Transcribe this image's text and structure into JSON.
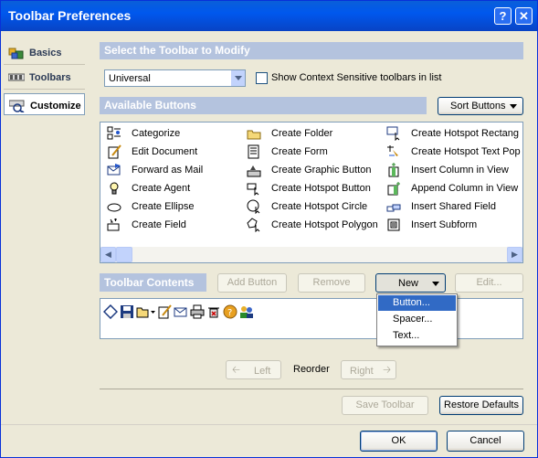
{
  "window": {
    "title": "Toolbar Preferences",
    "help_glyph": "?",
    "close_glyph": "✕"
  },
  "sidebar": {
    "items": [
      {
        "label": "Basics",
        "icon": "basics-icon",
        "selected": false
      },
      {
        "label": "Toolbars",
        "icon": "toolbars-icon",
        "selected": false
      },
      {
        "label": "Customize",
        "icon": "customize-icon",
        "selected": true
      }
    ]
  },
  "select_toolbar": {
    "heading": "Select the Toolbar to Modify",
    "value": "Universal",
    "context_checkbox_label": "Show Context Sensitive toolbars in list",
    "context_checked": false
  },
  "available": {
    "heading": "Available Buttons",
    "sort_label": "Sort Buttons",
    "columns": [
      [
        {
          "label": "Categorize",
          "icon": "categorize-icon"
        },
        {
          "label": "Edit Document",
          "icon": "edit-document-icon"
        },
        {
          "label": "Forward as Mail",
          "icon": "forward-mail-icon"
        },
        {
          "label": "Create Agent",
          "icon": "agent-icon"
        },
        {
          "label": "Create Ellipse",
          "icon": "ellipse-icon"
        },
        {
          "label": "Create Field",
          "icon": "field-icon"
        }
      ],
      [
        {
          "label": "Create Folder",
          "icon": "folder-icon"
        },
        {
          "label": "Create Form",
          "icon": "form-icon"
        },
        {
          "label": "Create Graphic Button",
          "icon": "graphic-button-icon"
        },
        {
          "label": "Create Hotspot Button",
          "icon": "hotspot-button-icon"
        },
        {
          "label": "Create Hotspot Circle",
          "icon": "hotspot-circle-icon"
        },
        {
          "label": "Create Hotspot Polygon",
          "icon": "hotspot-polygon-icon"
        }
      ],
      [
        {
          "label": "Create Hotspot Rectang",
          "icon": "hotspot-rectangle-icon"
        },
        {
          "label": "Create Hotspot Text Pop",
          "icon": "hotspot-text-pop-icon"
        },
        {
          "label": "Insert Column in View",
          "icon": "insert-column-icon"
        },
        {
          "label": "Append Column in View",
          "icon": "append-column-icon"
        },
        {
          "label": "Insert Shared Field",
          "icon": "shared-field-icon"
        },
        {
          "label": "Insert Subform",
          "icon": "subform-icon"
        }
      ]
    ]
  },
  "toolbar_contents": {
    "heading": "Toolbar Contents",
    "add_button": "Add Button",
    "remove_button": "Remove",
    "new_button": "New",
    "edit_button": "Edit...",
    "new_menu": [
      "Button...",
      "Spacer...",
      "Text..."
    ],
    "icons": [
      "toolbar-open-icon",
      "save-icon",
      "open-folder-icon",
      "edit-icon",
      "forward-icon",
      "print-icon",
      "delete-icon",
      "help-icon",
      "users-icon"
    ]
  },
  "reorder": {
    "left_label": "Left",
    "label": "Reorder",
    "right_label": "Right"
  },
  "footer": {
    "save_toolbar": "Save Toolbar",
    "restore_defaults": "Restore Defaults",
    "ok": "OK",
    "cancel": "Cancel"
  },
  "colors": {
    "title_bar": "#0058ee",
    "section_header": "#b4c3de",
    "menu_highlight": "#316ac5"
  }
}
